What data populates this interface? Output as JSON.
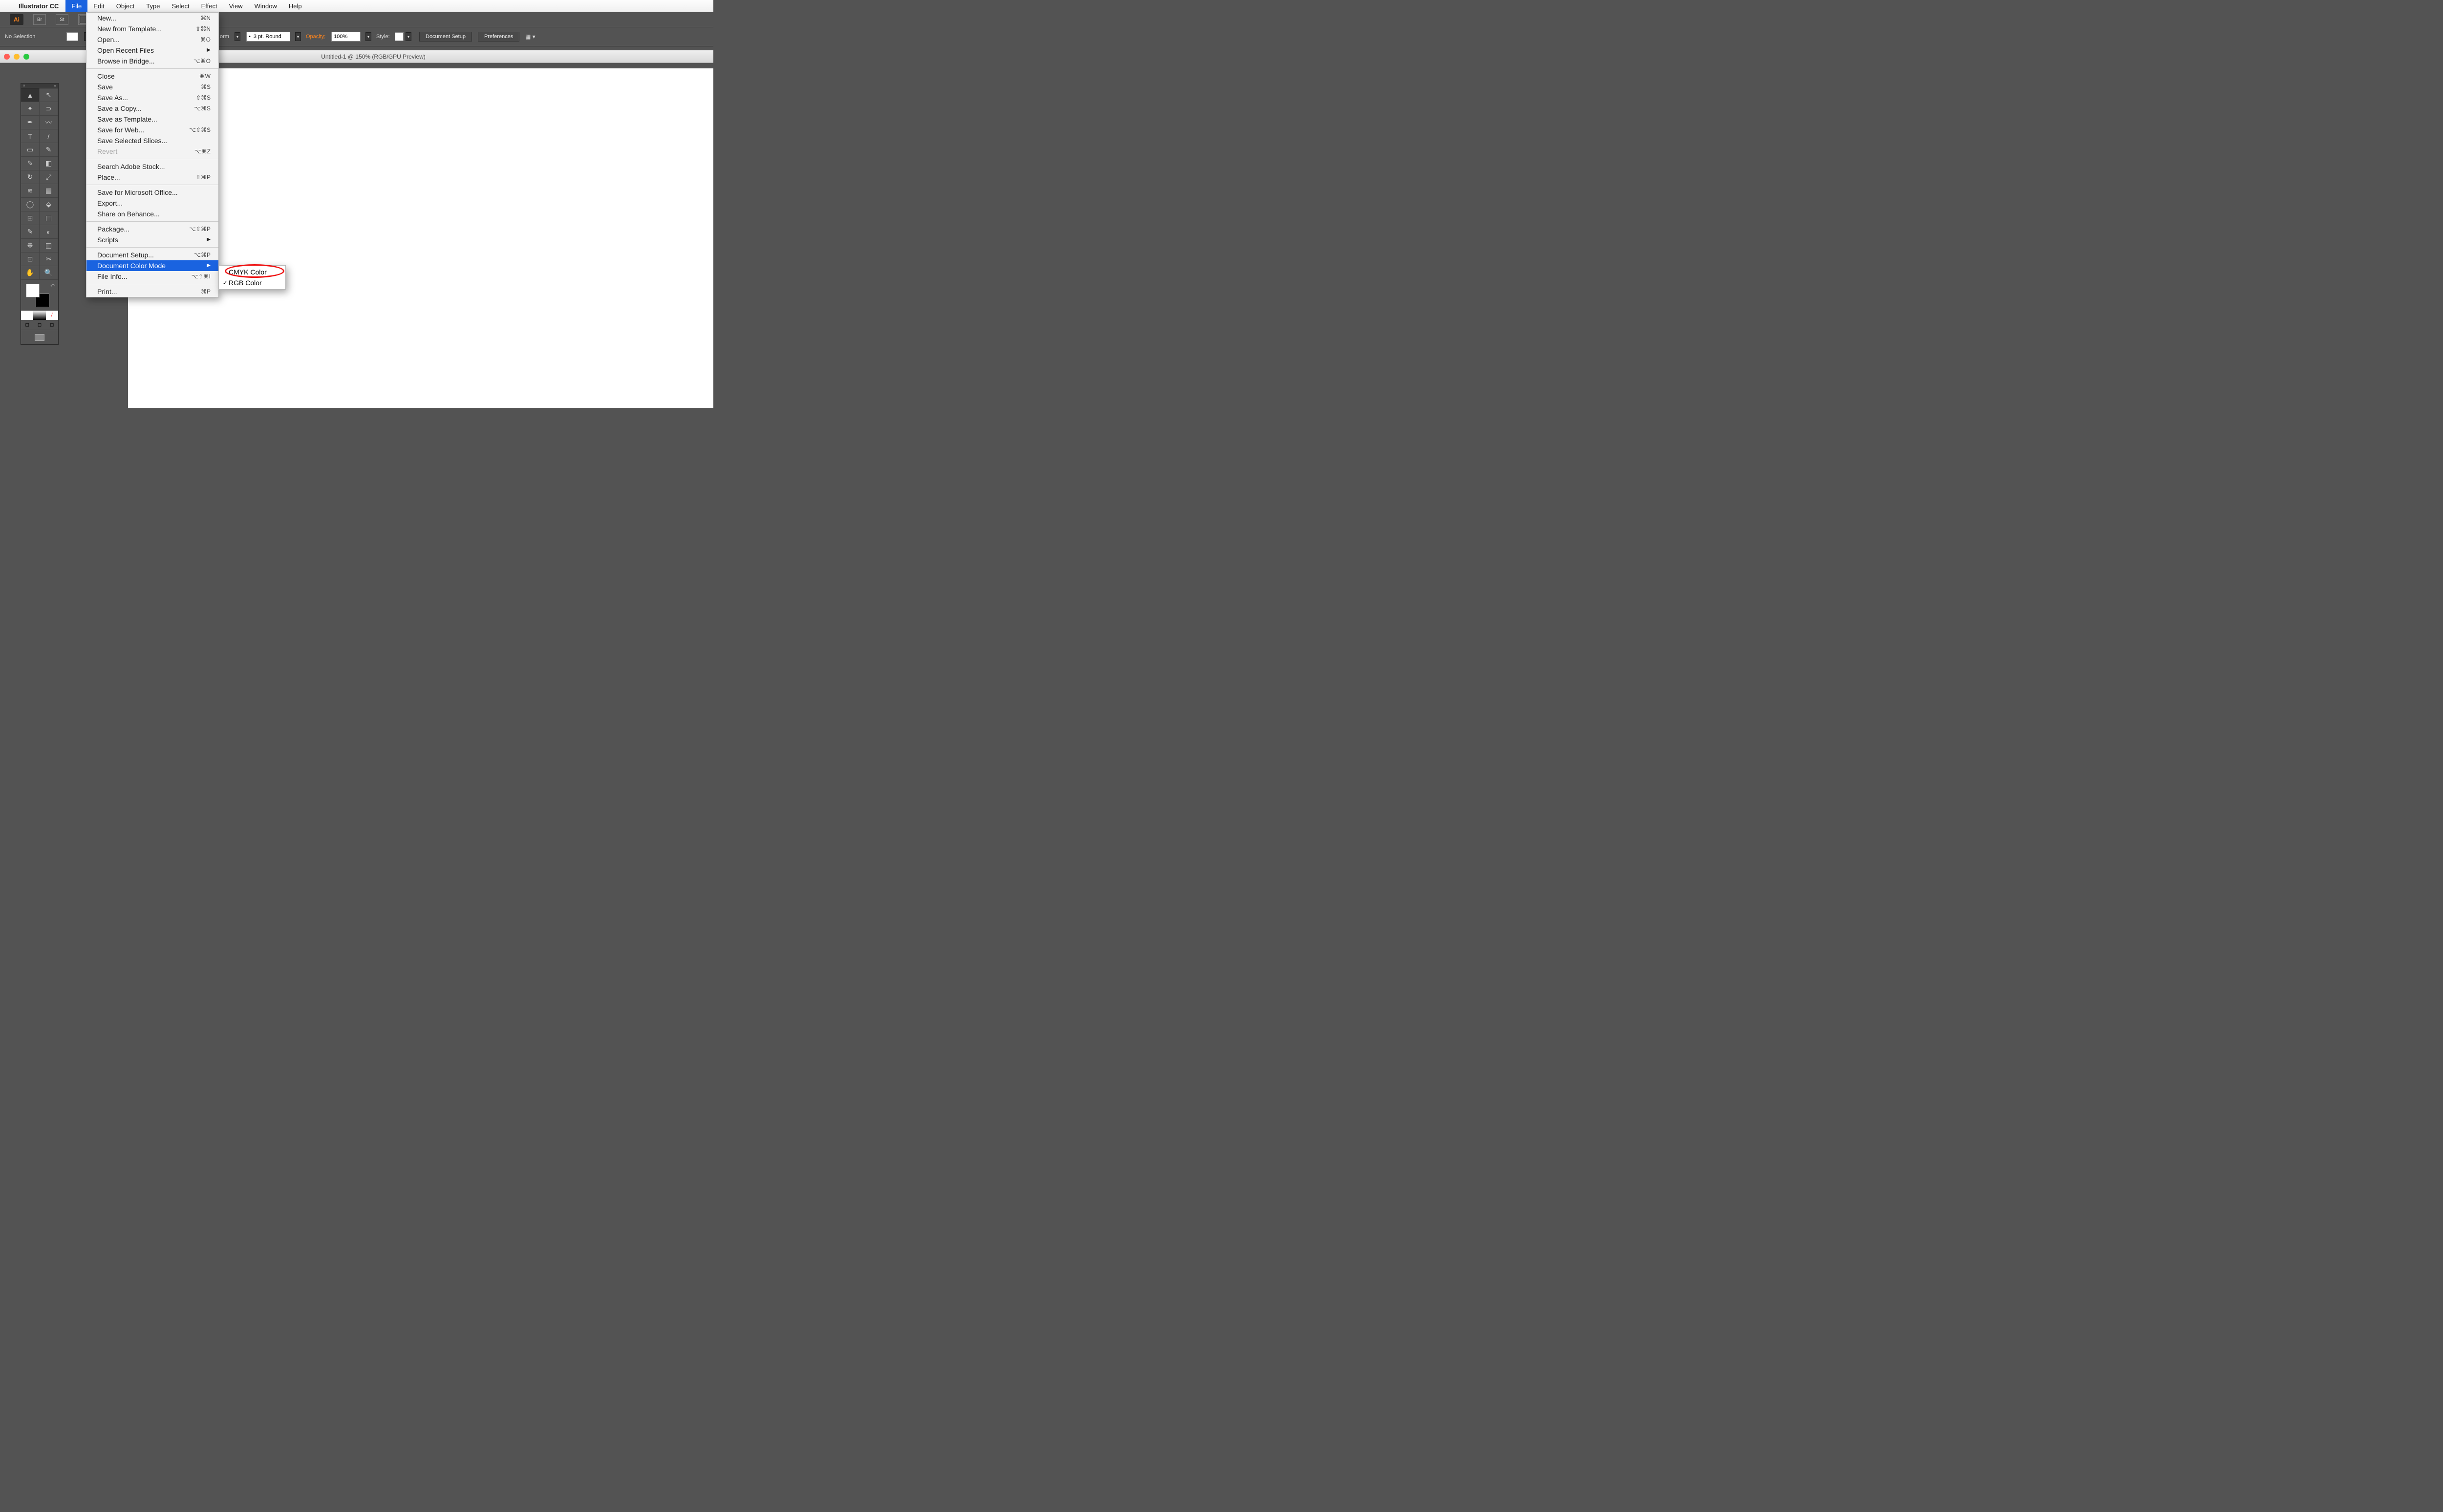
{
  "menubar": {
    "app": "Illustrator CC",
    "items": [
      "File",
      "Edit",
      "Object",
      "Type",
      "Select",
      "Effect",
      "View",
      "Window",
      "Help"
    ],
    "active": "File"
  },
  "appbar": {
    "logo": "Ai",
    "br": "Br",
    "st": "St"
  },
  "ctrl": {
    "sel": "No Selection",
    "stroke_unit": "orm",
    "brush": "3 pt. Round",
    "opacity_label": "Opacity:",
    "opacity": "100%",
    "style": "Style:",
    "btn_doc": "Document Setup",
    "btn_pref": "Preferences"
  },
  "doc": {
    "title": "Untitled-1 @ 150% (RGB/GPU Preview)"
  },
  "menu": {
    "g1": [
      {
        "l": "New...",
        "s": "⌘N"
      },
      {
        "l": "New from Template...",
        "s": "⇧⌘N"
      },
      {
        "l": "Open...",
        "s": "⌘O"
      },
      {
        "l": "Open Recent Files",
        "arrow": true
      },
      {
        "l": "Browse in Bridge...",
        "s": "⌥⌘O"
      }
    ],
    "g2": [
      {
        "l": "Close",
        "s": "⌘W"
      },
      {
        "l": "Save",
        "s": "⌘S"
      },
      {
        "l": "Save As...",
        "s": "⇧⌘S"
      },
      {
        "l": "Save a Copy...",
        "s": "⌥⌘S"
      },
      {
        "l": "Save as Template..."
      },
      {
        "l": "Save for Web...",
        "s": "⌥⇧⌘S"
      },
      {
        "l": "Save Selected Slices..."
      },
      {
        "l": "Revert",
        "s": "⌥⌘Z",
        "disabled": true
      }
    ],
    "g3": [
      {
        "l": "Search Adobe Stock..."
      },
      {
        "l": "Place...",
        "s": "⇧⌘P"
      }
    ],
    "g4": [
      {
        "l": "Save for Microsoft Office..."
      },
      {
        "l": "Export..."
      },
      {
        "l": "Share on Behance..."
      }
    ],
    "g5": [
      {
        "l": "Package...",
        "s": "⌥⇧⌘P"
      },
      {
        "l": "Scripts",
        "arrow": true
      }
    ],
    "g6": [
      {
        "l": "Document Setup...",
        "s": "⌥⌘P"
      },
      {
        "l": "Document Color Mode",
        "arrow": true,
        "hi": true
      },
      {
        "l": "File Info...",
        "s": "⌥⇧⌘I"
      }
    ],
    "g7": [
      {
        "l": "Print...",
        "s": "⌘P"
      }
    ]
  },
  "submenu": {
    "cmyk": "CMYK Color",
    "rgb": "RGB Color"
  }
}
